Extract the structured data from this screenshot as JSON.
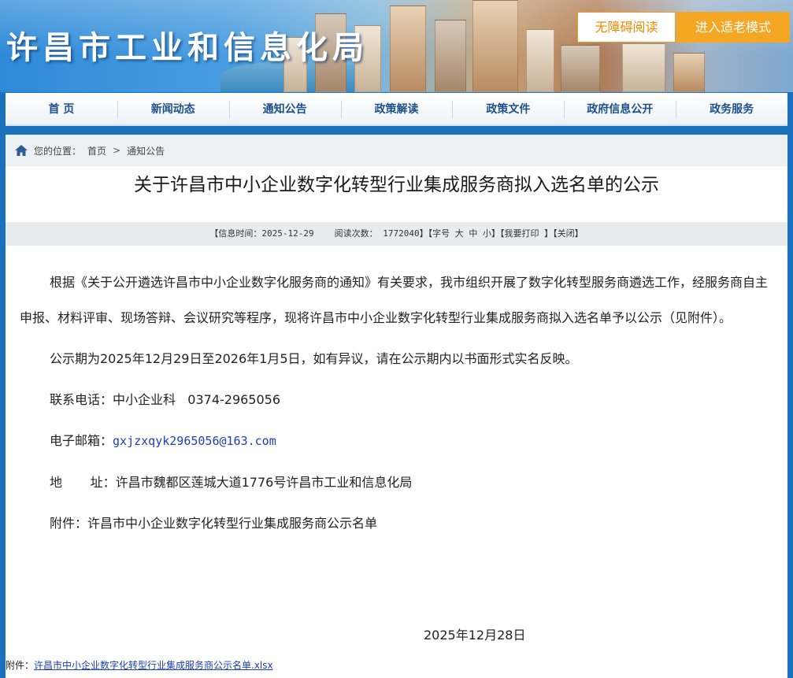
{
  "header": {
    "site_title": "许昌市工业和信息化局",
    "accessibility_button": "无障碍阅读",
    "elder_mode_button": "进入适老模式"
  },
  "nav": {
    "items": [
      "首 页",
      "新闻动态",
      "通知公告",
      "政策解读",
      "政策文件",
      "政府信息公开",
      "政务服务"
    ]
  },
  "breadcrumb": {
    "prefix": "您的位置：",
    "home": "首页",
    "separator": ">",
    "current": "通知公告"
  },
  "article": {
    "title": "关于许昌市中小企业数字化转型行业集成服务商拟入选名单的公示",
    "meta": {
      "info_time": "【信息时间：2025-12-29",
      "read_count": "阅读次数：  1772040",
      "font_size": "】【字号 大 中 小】",
      "print": "【我要打印 】",
      "close": "【关闭】"
    },
    "paragraph1": "根据《关于公开遴选许昌市中小企业数字化服务商的通知》有关要求，我市组织开展了数字化转型服务商遴选工作，经服务商自主申报、材料评审、现场答辩、会议研究等程序，现将许昌市中小企业数字化转型行业集成服务商拟入选名单予以公示（见附件）。",
    "paragraph2": "公示期为2025年12月29日至2026年1月5日，如有异议，请在公示期内以书面形式实名反映。",
    "phone_label": "联系电话：",
    "phone_value": "中小企业科   0374-2965056",
    "email_label": "电子邮箱：",
    "email_value": "gxjzxqyk2965056@163.com",
    "address_label": "地       址：",
    "address_value": "许昌市魏都区莲城大道1776号许昌市工业和信息化局",
    "attachment_line": "附件：许昌市中小企业数字化转型行业集成服务商公示名单",
    "date": "2025年12月28日",
    "attachment_prefix": "附件：",
    "attachment_link": "许昌市中小企业数字化转型行业集成服务商公示名单.xlsx"
  },
  "colors": {
    "nav_text": "#1d4f8a",
    "accent_orange": "#f5a623",
    "link": "#1a3fb8",
    "page_bg": "#1a72bf"
  }
}
